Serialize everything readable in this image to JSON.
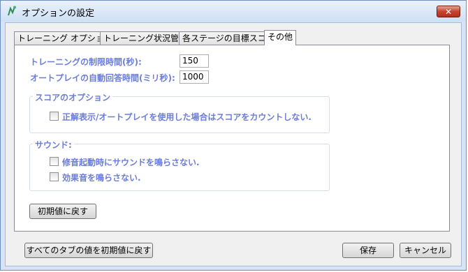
{
  "window": {
    "title": "オプションの設定",
    "close_label": "✕"
  },
  "tabs": [
    {
      "label": "トレーニング オプション"
    },
    {
      "label": "トレーニング状況管理"
    },
    {
      "label": "各ステージの目標スコア"
    },
    {
      "label": "その他"
    }
  ],
  "settings": {
    "time_limit_label": "トレーニングの制限時間(秒):",
    "time_limit_value": "150",
    "autoplay_label": "オートプレイの自動回答時間(ミリ秒):",
    "autoplay_value": "1000"
  },
  "score_group": {
    "legend": "スコアのオプション",
    "option_label": "正解表示/オートプレイを使用した場合はスコアをカウントしない."
  },
  "sound_group": {
    "legend": "サウンド:",
    "option1_label": "修音起動時にサウンドを鳴らさない.",
    "option2_label": "効果音を鳴らさない."
  },
  "buttons": {
    "reset_page": "初期値に戻す",
    "reset_all": "すべてのタブの値を初期値に戻す",
    "save": "保存",
    "cancel": "キャンセル"
  }
}
